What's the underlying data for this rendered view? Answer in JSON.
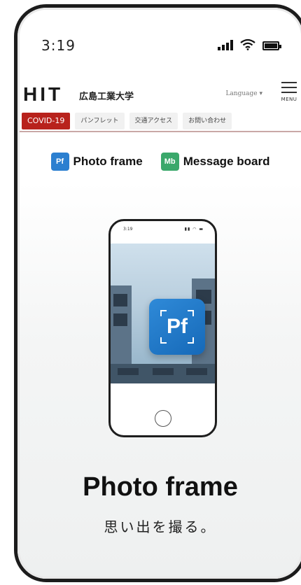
{
  "status_bar": {
    "time": "3:19"
  },
  "header": {
    "logo": "HIT",
    "university_name": "広島工業大学",
    "language": "Language ▾",
    "menu_label": "MENU"
  },
  "tabs": [
    {
      "label": "COVID-19",
      "active": true
    },
    {
      "label": "パンフレット",
      "active": false
    },
    {
      "label": "交通アクセス",
      "active": false
    },
    {
      "label": "お問い合わせ",
      "active": false
    }
  ],
  "app_links": [
    {
      "badge": "Pf",
      "label": "Photo frame",
      "color": "#2b7fd0"
    },
    {
      "badge": "Mb",
      "label": "Message board",
      "color": "#3aa86b"
    }
  ],
  "hero": {
    "device_time": "3:19",
    "device_icons": "▮▮ ◠ ▬",
    "app_icon_text": "Pf",
    "title": "Photo frame",
    "subtitle": "思い出を撮る。"
  },
  "colors": {
    "accent_red": "#b8221c",
    "pf_blue": "#1f78c9",
    "mb_green": "#3aa86b"
  }
}
